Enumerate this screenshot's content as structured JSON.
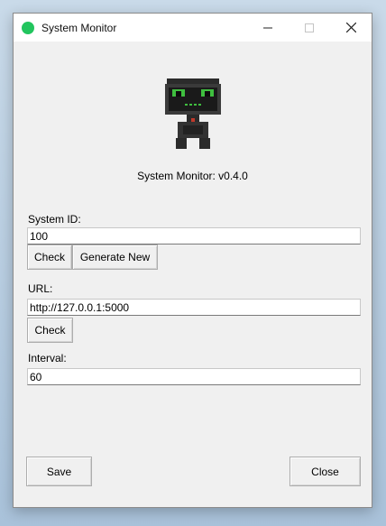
{
  "window": {
    "title": "System Monitor",
    "app_icon_color": "#22c55e",
    "controls": {
      "minimize": "minimize-icon",
      "maximize": "maximize-icon",
      "close": "close-icon"
    }
  },
  "logo": {
    "icon": "robot-logo",
    "eye_color": "#3fbf3f"
  },
  "version_text": "System Monitor: v0.4.0",
  "system_id": {
    "label": "System ID:",
    "value": "100",
    "check_label": "Check",
    "generate_label": "Generate New"
  },
  "url": {
    "label": "URL:",
    "value": "http://127.0.0.1:5000",
    "check_label": "Check"
  },
  "interval": {
    "label": "Interval:",
    "value": "60"
  },
  "footer": {
    "save_label": "Save",
    "close_label": "Close"
  }
}
